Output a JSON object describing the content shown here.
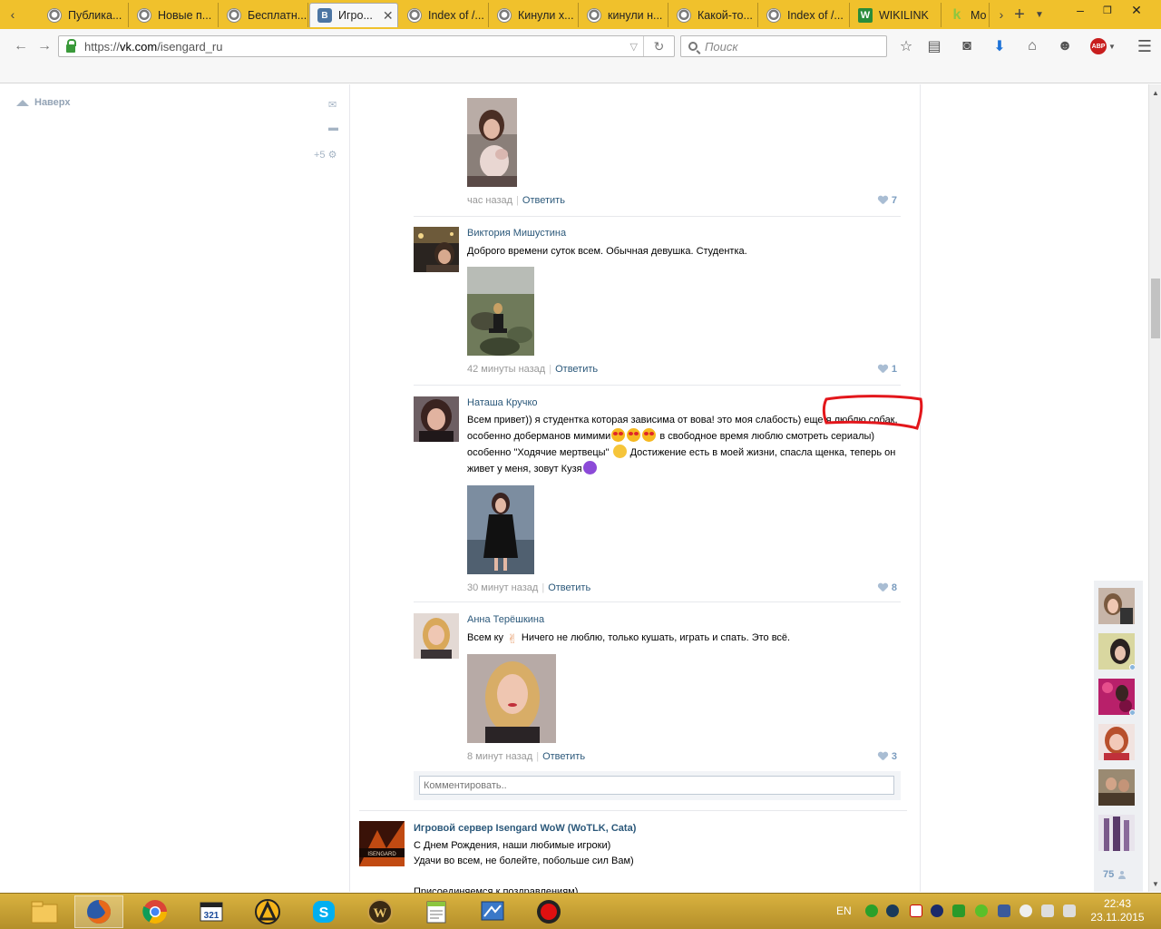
{
  "browser": {
    "tabs": [
      {
        "label": "Публика...",
        "icon": "generic-page-icon"
      },
      {
        "label": "Новые п...",
        "icon": "generic-page-icon"
      },
      {
        "label": "Бесплатн...",
        "icon": "generic-page-icon"
      },
      {
        "label": "Игро...",
        "icon": "vk-icon",
        "active": true
      },
      {
        "label": "Index of /...",
        "icon": "generic-page-icon"
      },
      {
        "label": "Кинули х...",
        "icon": "generic-page-icon"
      },
      {
        "label": "кинули н...",
        "icon": "generic-page-icon"
      },
      {
        "label": "Какой-то...",
        "icon": "generic-page-icon"
      },
      {
        "label": "Index of /...",
        "icon": "generic-page-icon"
      },
      {
        "label": "WIKILINK",
        "icon": "wikilink-icon"
      },
      {
        "label": "Мо",
        "icon": "k-icon"
      }
    ],
    "url": {
      "prefix": "https://",
      "host": "vk.com",
      "path": "/isengard_ru"
    },
    "search_placeholder": "Поиск",
    "vk_badge": "В",
    "wiki_badge": "W",
    "k_badge": "k",
    "abp_badge": "ABP"
  },
  "sidebar": {
    "to_top": "Наверх",
    "counter": "+5"
  },
  "comments": [
    {
      "author": "",
      "text_lines": [],
      "time": "час назад",
      "reply": "Ответить",
      "likes": "7"
    },
    {
      "author": "Виктория Мишустина",
      "text_lines": [
        "Доброго времени суток всем. Обычная девушка. Студентка."
      ],
      "time": "42 минуты назад",
      "reply": "Ответить",
      "likes": "1"
    },
    {
      "author": "Наташа Кручко",
      "text_lines": [
        "Всем привет)) я студентка которая зависима от вова! это моя слабость) еще я люблю собак,",
        "особенно доберманов мимими",
        "в свободное время люблю смотреть сериалы)",
        "особенно \"Ходячие мертвецы\"",
        "Достижение есть в моей жизни, спасла щенка, теперь он",
        "живет у меня, зовут Кузя"
      ],
      "time": "30 минут назад",
      "reply": "Ответить",
      "likes": "8"
    },
    {
      "author": "Анна Терёшкина",
      "text_lines": [
        "Всем ку",
        "Ничего не люблю, только кушать, играть и спать. Это всё."
      ],
      "time": "8 минут назад",
      "reply": "Ответить",
      "likes": "3"
    }
  ],
  "comment_input": {
    "placeholder": "Комментировать.."
  },
  "next_post": {
    "author": "Игровой сервер Isengard WoW (WoTLK, Cata)",
    "avatar_text": "ISENGARD",
    "lines": [
      "С Днем Рождения, наши любимые игроки)",
      "Удачи во всем, не болейте, побольше сил Вам)",
      "",
      "Присоединяемся к поздравлениям)"
    ]
  },
  "friends": {
    "count": "75"
  },
  "taskbar": {
    "lang": "EN",
    "time": "22:43",
    "date": "23.11.2015",
    "apps": [
      "file-explorer-icon",
      "firefox-icon",
      "chrome-icon",
      "media-player-classic-icon",
      "aimp-icon",
      "skype-icon",
      "warcraft-launcher-icon",
      "notepad-plus-icon",
      "remote-desktop-icon",
      "record-icon"
    ],
    "app_labels": {
      "mpc": "321",
      "wow": "W"
    }
  },
  "colors": {
    "vk_link": "#2b587a",
    "firefox_theme": "#f0c12c",
    "annotation": "#e3161b",
    "like": "#7a9cbf"
  }
}
